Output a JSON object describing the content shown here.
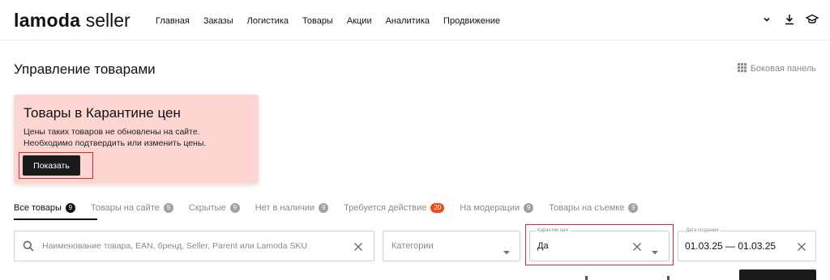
{
  "header": {
    "logo_brand": "lamoda",
    "logo_seller": "seller",
    "nav": [
      "Главная",
      "Заказы",
      "Логистика",
      "Товары",
      "Акции",
      "Аналитика",
      "Продвижение"
    ]
  },
  "page": {
    "title": "Управление товарами",
    "side_panel_label": "Боковая панель"
  },
  "quarantine_card": {
    "title": "Товары в Карантине цен",
    "line1": "Цены таких товаров не обновлены на сайте.",
    "line2": "Необходимо подтвердить или изменить цены.",
    "button_label": "Показать",
    "background_color": "#fdd6d2"
  },
  "tabs": [
    {
      "label": "Все товары",
      "count": "9",
      "active": true
    },
    {
      "label": "Товары на сайте",
      "count": "9"
    },
    {
      "label": "Скрытые",
      "count": "9"
    },
    {
      "label": "Нет в наличии",
      "count": "9"
    },
    {
      "label": "Требуется действие",
      "count": "20",
      "highlight": true
    },
    {
      "label": "На модерации",
      "count": "9"
    },
    {
      "label": "Товары на съемке",
      "count": "9"
    }
  ],
  "filters": {
    "search_placeholder": "Наименование товара, EAN, бренд, Seller, Parent или Lamoda SKU",
    "category_placeholder": "Категории",
    "quarantine_legend": "Карантин цен",
    "quarantine_value": "Да",
    "date_legend": "Дата создания",
    "date_value": "01.03.25 — 01.03.25"
  },
  "colors": {
    "accent_red": "#e2232f",
    "badge_red": "#f24a17",
    "dark": "#1b1b1b"
  }
}
